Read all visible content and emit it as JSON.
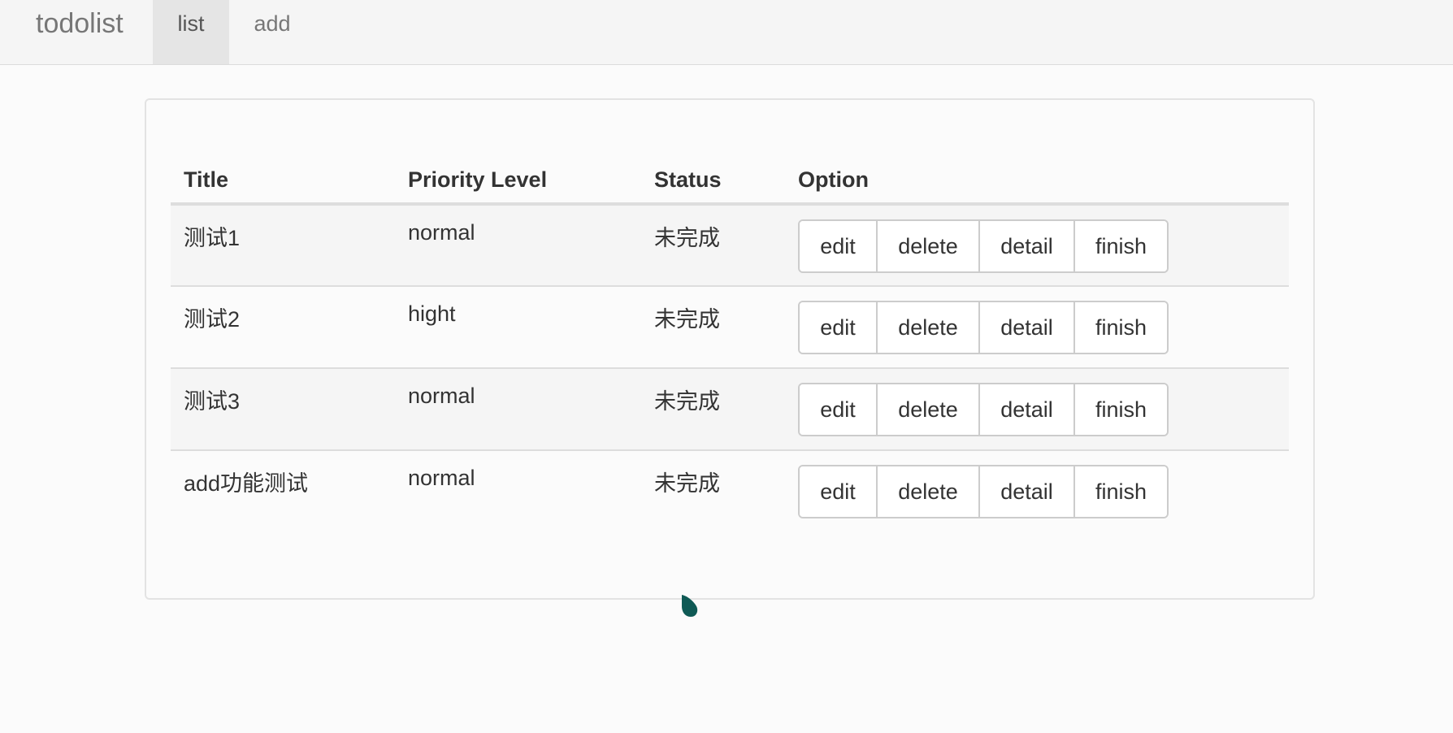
{
  "navbar": {
    "brand": "todolist",
    "tabs": [
      {
        "label": "list",
        "active": true
      },
      {
        "label": "add",
        "active": false
      }
    ]
  },
  "table": {
    "headers": {
      "title": "Title",
      "priority": "Priority Level",
      "status": "Status",
      "option": "Option"
    },
    "rows": [
      {
        "title": "测试1",
        "priority": "normal",
        "status": "未完成"
      },
      {
        "title": "测试2",
        "priority": "hight",
        "status": "未完成"
      },
      {
        "title": "测试3",
        "priority": "normal",
        "status": "未完成"
      },
      {
        "title": "add功能测试",
        "priority": "normal",
        "status": "未完成"
      }
    ],
    "actions": {
      "edit": "edit",
      "delete": "delete",
      "detail": "detail",
      "finish": "finish"
    }
  },
  "colors": {
    "cursor": "#0f5a55",
    "row_stripe": "#f5f5f5",
    "active_tab": "#e5e5e5"
  }
}
